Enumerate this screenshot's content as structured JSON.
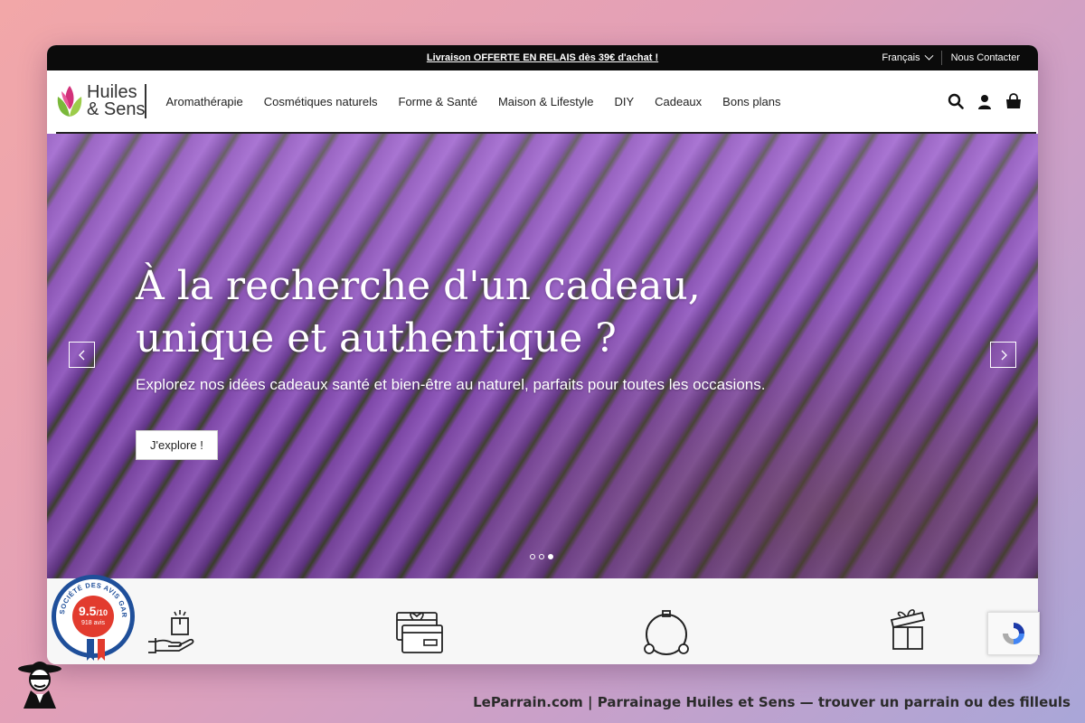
{
  "topbar": {
    "promo": "Livraison OFFERTE EN RELAIS dès 39€ d'achat !",
    "language": "Français",
    "contact": "Nous Contacter"
  },
  "logo": {
    "line1": "Huiles",
    "line2": "& Sens"
  },
  "nav": [
    "Aromathérapie",
    "Cosmétiques naturels",
    "Forme & Santé",
    "Maison & Lifestyle",
    "DIY",
    "Cadeaux",
    "Bons plans"
  ],
  "icons": {
    "search": "search-icon",
    "account": "user-icon",
    "cart": "shopping-bag-icon"
  },
  "hero": {
    "title_line1": "À la recherche d'un cadeau,",
    "title_line2": "unique et authentique ?",
    "subtitle": "Explorez nos idées cadeaux santé et bien-être au naturel, parfaits pour toutes les occasions.",
    "cta": "J'explore !",
    "slides": 3,
    "active_slide": 3
  },
  "badge": {
    "ring_text": "SOCIÉTÉ DES AVIS GARANTIS",
    "score": "9.5",
    "scale": "/10",
    "count": "918 avis"
  },
  "features": [
    "hand-package-icon",
    "gift-card-icon",
    "essential-oil-icon",
    "gift-box-icon"
  ],
  "caption": "LeParrain.com | Parrainage Huiles et Sens — trouver un parrain ou des filleuls",
  "colors": {
    "topbar": "#0b0b0b",
    "badge_blue": "#1f4f9a",
    "badge_red": "#e23b2e",
    "logo_green": "#7ab83a",
    "logo_pink": "#d2317a"
  }
}
